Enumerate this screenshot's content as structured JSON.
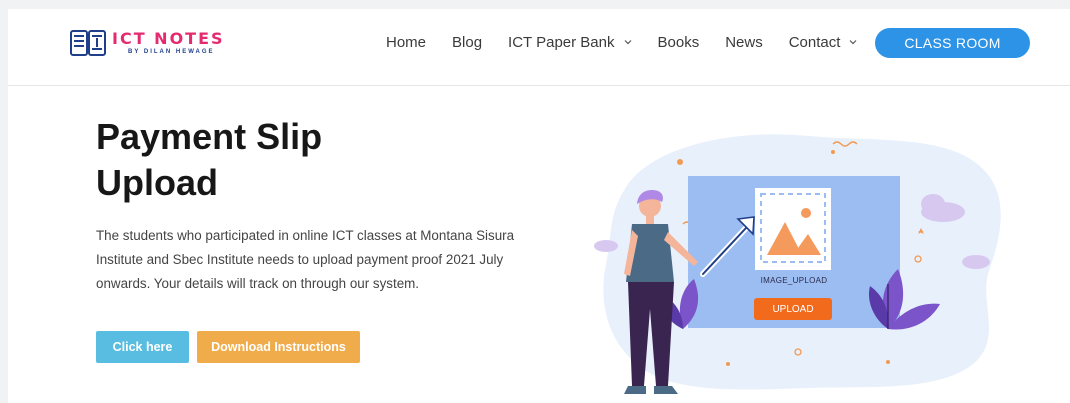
{
  "logo": {
    "title": "ICT NOTES",
    "subtitle": "BY DILAN HEWAGE"
  },
  "nav": {
    "items": [
      {
        "label": "Home",
        "dropdown": false
      },
      {
        "label": "Blog",
        "dropdown": false
      },
      {
        "label": "ICT Paper Bank",
        "dropdown": true
      },
      {
        "label": "Books",
        "dropdown": false
      },
      {
        "label": "News",
        "dropdown": false
      },
      {
        "label": "Contact",
        "dropdown": true
      }
    ],
    "cta": "CLASS ROOM"
  },
  "hero": {
    "title_line1": "Payment Slip",
    "title_line2": "Upload",
    "description": "The students who participated in online ICT classes at Montana Sisura Institute and Sbec Institute needs to upload payment proof 2021 July onwards. Your details will track on through our system.",
    "click_label": "Click here",
    "download_label": "Download Instructions"
  },
  "illustration": {
    "image_label": "IMAGE_UPLOAD",
    "upload_label": "UPLOAD"
  },
  "colors": {
    "brand_pink": "#e52a6f",
    "brand_navy": "#1f3f8a",
    "cta_blue": "#2d93e6",
    "click_blue": "#58bde0",
    "download_orange": "#f0ac4b",
    "upload_orange": "#f26a1b"
  }
}
